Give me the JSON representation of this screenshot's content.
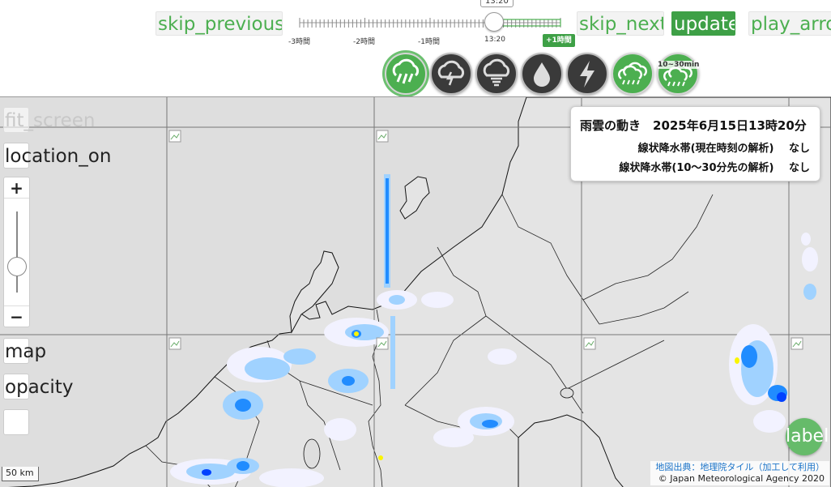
{
  "toolbar": {
    "skip_previous_label": "skip_previous",
    "skip_next_label": "skip_next",
    "update_label": "update",
    "play_label": "play_arro"
  },
  "time_slider": {
    "current_time": "13:20",
    "tick_labels": [
      "-3時間",
      "-2時間",
      "-1時間",
      "13:20"
    ],
    "forecast_badge": "+1時間",
    "position_fraction": 0.75
  },
  "layers": {
    "buttons": [
      {
        "id": "rain-cloud",
        "icon": "rain-cloud-icon",
        "selected": true
      },
      {
        "id": "thunder-cloud",
        "icon": "thunder-cloud-icon",
        "selected": false
      },
      {
        "id": "tornado-cloud",
        "icon": "tornado-cloud-icon",
        "selected": false
      },
      {
        "id": "drop",
        "icon": "water-drop-icon",
        "selected": false
      },
      {
        "id": "lightning",
        "icon": "lightning-icon",
        "selected": false
      },
      {
        "id": "linear-rainband",
        "icon": "linear-rainband-icon",
        "selected": false
      },
      {
        "id": "linear-rainband-forecast",
        "icon": "linear-rainband-forecast-icon",
        "selected": false
      }
    ],
    "forecast_badge": "10~30min"
  },
  "map_controls": {
    "fit_screen_label": "fit_screen",
    "location_label": "location_on",
    "zoom_in": "+",
    "zoom_out": "−",
    "map_label": "map",
    "opacity_label": "opacity",
    "label_fab": "label"
  },
  "info_panel": {
    "title": "雨雲の動き　2025年6月15日13時20分",
    "rows": [
      {
        "label": "線状降水帯(現在時刻の解析)",
        "value": "なし"
      },
      {
        "label": "線状降水帯(10～30分先の解析)",
        "value": "なし"
      }
    ]
  },
  "scale": {
    "label": "50 km"
  },
  "attribution": {
    "line1": "地図出典：地理院タイル（加工して利用）",
    "line2": "© Japan Meteorological Agency 2020"
  },
  "colors": {
    "accent_green": "#4caf50",
    "map_background": "#dcdcdc",
    "rain_light": "#f2f2ff",
    "rain_moderate": "#a0d2ff",
    "rain_heavy": "#218cff",
    "rain_very_heavy": "#0041ff",
    "rain_intense": "#faf500"
  }
}
